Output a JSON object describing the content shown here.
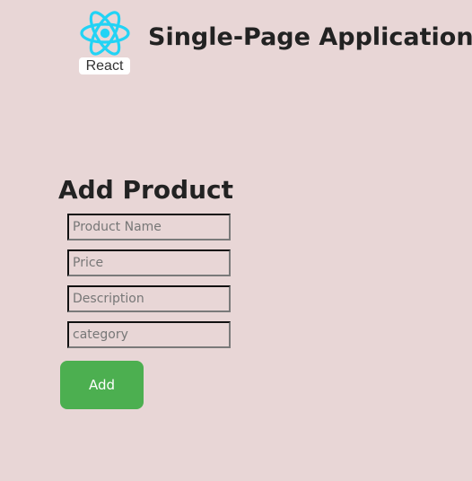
{
  "header": {
    "logo_text": "React",
    "logo_icon": "react-atom-icon",
    "title": "Single-Page Application"
  },
  "form": {
    "title": "Add Product",
    "fields": [
      {
        "placeholder": "Product Name",
        "value": ""
      },
      {
        "placeholder": "Price",
        "value": ""
      },
      {
        "placeholder": "Description",
        "value": ""
      },
      {
        "placeholder": "category",
        "value": ""
      }
    ],
    "submit_label": "Add"
  },
  "colors": {
    "background": "#e8d6d6",
    "button": "#4caf50",
    "button_text": "#ffffff",
    "react_logo": "#22d3f5"
  }
}
